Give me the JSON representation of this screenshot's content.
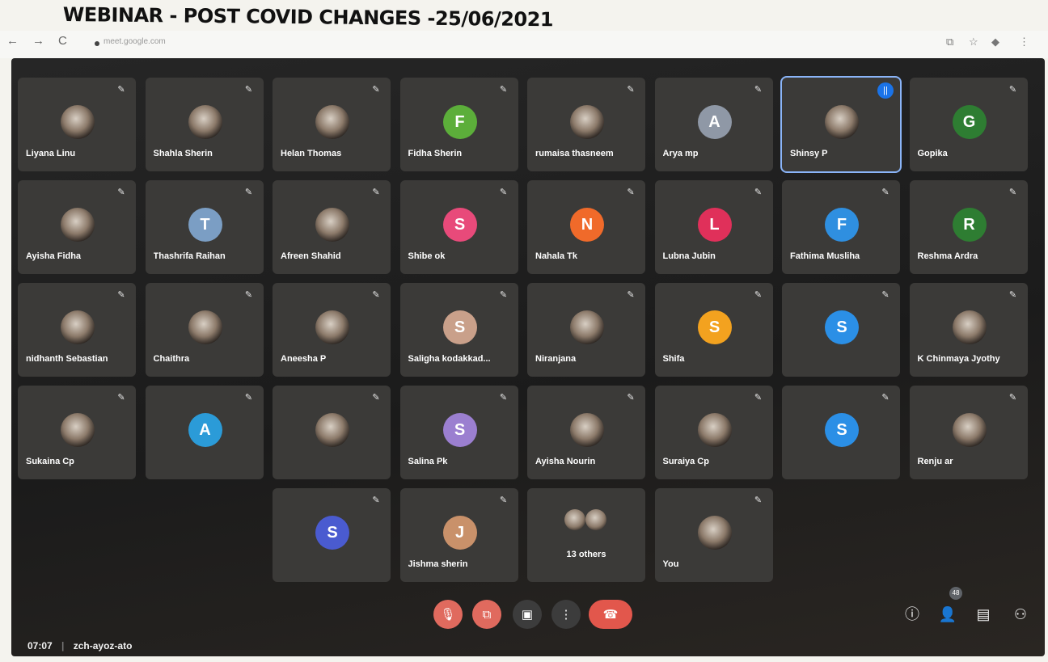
{
  "caption": "WEBINAR - POST COVID CHANGES -25/06/2021",
  "browser": {
    "back": "←",
    "forward": "→",
    "reload": "C",
    "url": "meet.google.com",
    "extension_icon": "⧉",
    "star_icon": "☆",
    "menu_icon": "⋮"
  },
  "participants": [
    {
      "name": "Liyana Linu",
      "initial": "",
      "color": "",
      "row": 0,
      "col": 0
    },
    {
      "name": "Shahla Sherin",
      "initial": "",
      "color": "",
      "row": 0,
      "col": 1
    },
    {
      "name": "Helan Thomas",
      "initial": "",
      "color": "",
      "row": 0,
      "col": 2
    },
    {
      "name": "Fidha Sherin",
      "initial": "F",
      "color": "#5cae3a",
      "row": 0,
      "col": 3
    },
    {
      "name": "rumaisa thasneem",
      "initial": "",
      "color": "",
      "row": 0,
      "col": 4
    },
    {
      "name": "Arya mp",
      "initial": "A",
      "color": "#8f98a6",
      "row": 0,
      "col": 5
    },
    {
      "name": "Shinsy P",
      "initial": "",
      "color": "",
      "row": 0,
      "col": 6,
      "speaking": true
    },
    {
      "name": "Gopika",
      "initial": "G",
      "color": "#2e7d32",
      "row": 0,
      "col": 7
    },
    {
      "name": "Ayisha Fidha",
      "initial": "",
      "color": "",
      "row": 1,
      "col": 0
    },
    {
      "name": "Thashrifa Raihan",
      "initial": "T",
      "color": "#7b9ec4",
      "row": 1,
      "col": 1
    },
    {
      "name": "Afreen Shahid",
      "initial": "",
      "color": "",
      "row": 1,
      "col": 2
    },
    {
      "name": "Shibe ok",
      "initial": "S",
      "color": "#e84a7a",
      "row": 1,
      "col": 3
    },
    {
      "name": "Nahala Tk",
      "initial": "N",
      "color": "#f06a2a",
      "row": 1,
      "col": 4
    },
    {
      "name": "Lubna Jubin",
      "initial": "L",
      "color": "#e0305a",
      "row": 1,
      "col": 5
    },
    {
      "name": "Fathima Musliha",
      "initial": "F",
      "color": "#2f8fe0",
      "row": 1,
      "col": 6
    },
    {
      "name": "Reshma Ardra",
      "initial": "R",
      "color": "#2e7d32",
      "row": 1,
      "col": 7
    },
    {
      "name": "nidhanth Sebastian",
      "initial": "",
      "color": "",
      "row": 2,
      "col": 0
    },
    {
      "name": "Chaithra",
      "initial": "",
      "color": "",
      "row": 2,
      "col": 1
    },
    {
      "name": "Aneesha P",
      "initial": "",
      "color": "",
      "row": 2,
      "col": 2
    },
    {
      "name": "Saligha kodakkad...",
      "initial": "S",
      "color": "#c9a08a",
      "row": 2,
      "col": 3
    },
    {
      "name": "Niranjana",
      "initial": "",
      "color": "",
      "row": 2,
      "col": 4
    },
    {
      "name": "Shifa",
      "initial": "S",
      "color": "#f3a21f",
      "row": 2,
      "col": 5
    },
    {
      "name": "",
      "initial": "S",
      "color": "#2b8fe6",
      "row": 2,
      "col": 6
    },
    {
      "name": "K Chinmaya Jyothy",
      "initial": "",
      "color": "",
      "row": 2,
      "col": 7
    },
    {
      "name": "Sukaina Cp",
      "initial": "",
      "color": "",
      "row": 3,
      "col": 0
    },
    {
      "name": "",
      "initial": "A",
      "color": "#2b9bd8",
      "row": 3,
      "col": 1
    },
    {
      "name": "",
      "initial": "",
      "color": "",
      "row": 3,
      "col": 2
    },
    {
      "name": "Salina Pk",
      "initial": "S",
      "color": "#9b7fd0",
      "row": 3,
      "col": 3
    },
    {
      "name": "Ayisha Nourin",
      "initial": "",
      "color": "",
      "row": 3,
      "col": 4
    },
    {
      "name": "Suraiya Cp",
      "initial": "",
      "color": "",
      "row": 3,
      "col": 5
    },
    {
      "name": "",
      "initial": "S",
      "color": "#2b8fe6",
      "row": 3,
      "col": 6
    },
    {
      "name": "Renju ar",
      "initial": "",
      "color": "",
      "row": 3,
      "col": 7
    },
    {
      "name": "",
      "initial": "S",
      "color": "#4a5bd0",
      "row": 4,
      "col": 2
    },
    {
      "name": "Jishma sherin",
      "initial": "J",
      "color": "#c9916a",
      "row": 4,
      "col": 3
    }
  ],
  "others_tile": {
    "label": "13 others",
    "row": 4,
    "col": 4
  },
  "self_tile": {
    "label": "You",
    "row": 4,
    "col": 5
  },
  "meeting": {
    "time": "07:07",
    "separator": "|",
    "code": "zch-ayoz-ato"
  },
  "controls": {
    "mic_icon": "🎙",
    "camera_icon": "⧉",
    "present_icon": "▣",
    "more_icon": "⋮",
    "end_icon": "☎"
  },
  "side_panel": {
    "info_icon": "ⓘ",
    "people_icon": "👤",
    "people_count": "48",
    "chat_icon": "▤",
    "activities_icon": "⚇"
  },
  "speaking_icon": "||",
  "muted_icon": "✎"
}
